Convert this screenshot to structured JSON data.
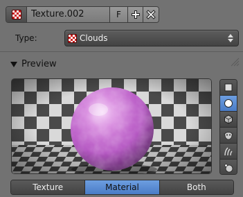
{
  "texture": {
    "name": "Texture.002",
    "fake_user_label": "F",
    "icon": "checker-texture-icon",
    "new_icon": "plus-icon",
    "unlink_icon": "close-icon"
  },
  "type": {
    "label": "Type:",
    "value": "Clouds",
    "icon": "checker-texture-icon"
  },
  "preview": {
    "header": "Preview",
    "preview_types": [
      {
        "icon": "plane-icon",
        "active": false
      },
      {
        "icon": "sphere-icon",
        "active": true
      },
      {
        "icon": "cube-icon",
        "active": false
      },
      {
        "icon": "monkey-icon",
        "active": false
      },
      {
        "icon": "hair-icon",
        "active": false
      },
      {
        "icon": "world-sphere-icon",
        "active": false
      }
    ]
  },
  "tabs": [
    {
      "label": "Texture",
      "active": false
    },
    {
      "label": "Material",
      "active": true
    },
    {
      "label": "Both",
      "active": false
    }
  ],
  "colors": {
    "panel_bg": "#727272",
    "accent_active": "#5b8dd6",
    "sphere": "#c86ad0"
  }
}
